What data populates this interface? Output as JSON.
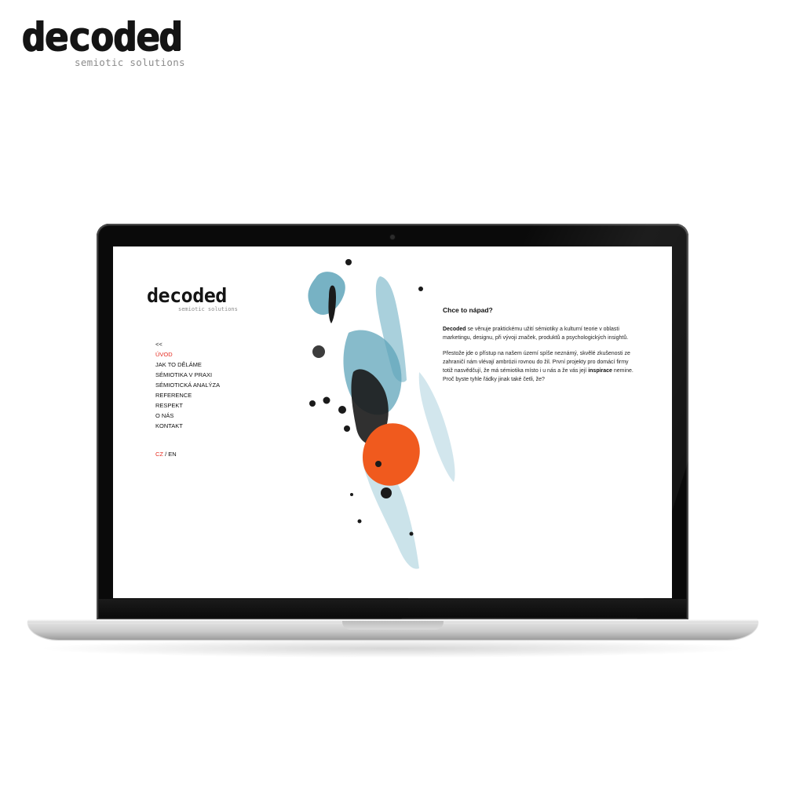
{
  "brand": {
    "name": "decoded",
    "tagline": "semiotic solutions"
  },
  "site": {
    "logo": {
      "name": "decoded",
      "tagline": "semiotic solutions"
    },
    "nav": {
      "back": "<<",
      "items": [
        {
          "label": "ÚVOD",
          "active": true
        },
        {
          "label": "JAK TO DĚLÁME",
          "active": false
        },
        {
          "label": "SÉMIOTIKA V PRAXI",
          "active": false
        },
        {
          "label": "SÉMIOTICKÁ ANALÝZA",
          "active": false
        },
        {
          "label": "REFERENCE",
          "active": false
        },
        {
          "label": "RESPEKT",
          "active": false
        },
        {
          "label": "O NÁS",
          "active": false
        },
        {
          "label": "KONTAKT",
          "active": false
        }
      ]
    },
    "language": {
      "cz": "CZ",
      "separator": " / ",
      "en": "EN"
    },
    "content": {
      "heading": "Chce to nápad?",
      "p1_bold": "Decoded",
      "p1_rest": " se věnuje praktickému užití sémiotiky a kulturní teorie v oblasti marketingu, designu, při vývoji značek, produktů a psychologických insightů.",
      "p2_start": "Přestože jde o přístup na našem území spíše neznámý, skvělé zkušenosti ze zahraničí nám vlévají ambrózii rovnou do žil. První projekty pro domácí firmy totiž nasvědčují, že má sémiotika místo i u nás a že vás její ",
      "p2_bold": "inspirace",
      "p2_end": " nemine. Proč byste tyhle řádky jinak také četli, že?"
    },
    "colors": {
      "accent_red": "#e52a1f",
      "ink_blue": "#5fa4ba",
      "ink_orange": "#f05a1e",
      "ink_black": "#1a1a1a"
    }
  }
}
